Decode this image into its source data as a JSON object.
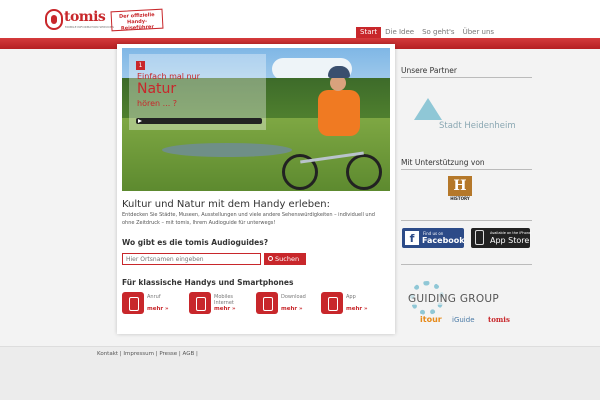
{
  "header": {
    "logo_text": "tomis",
    "logo_tagline": "MOBILE INFORMATION SERVICES",
    "stamp_text": "Der offizielle Handy-Reiseführer"
  },
  "nav": {
    "items": [
      {
        "label": "Start",
        "active": true
      },
      {
        "label": "Die Idee",
        "active": false
      },
      {
        "label": "So geht's",
        "active": false
      },
      {
        "label": "Über uns",
        "active": false
      }
    ]
  },
  "hero": {
    "badge_number": "1",
    "line1": "Einfach mal nur",
    "line2": "Natur",
    "line3": "hören ... ?"
  },
  "main": {
    "headline": "Kultur und Natur mit dem Handy erleben:",
    "intro": "Entdecken Sie Städte, Museen, Ausstellungen und viele andere Sehenswürdigkeiten – individuell und ohne Zeitdruck – mit tomis, Ihrem Audioguide für unterwegs!",
    "search_question": "Wo gibt es die tomis Audioguides?",
    "search_placeholder": "Hier Ortsnamen eingeben",
    "search_button": "Suchen",
    "subheading": "Für klassische Handys und Smartphones",
    "features": [
      {
        "title": "Anruf",
        "more": "mehr »"
      },
      {
        "title": "Mobiles Internet",
        "more": "mehr »"
      },
      {
        "title": "Download",
        "more": "mehr »"
      },
      {
        "title": "App",
        "more": "mehr »"
      }
    ]
  },
  "sidebar": {
    "partner_heading": "Unsere Partner",
    "partner_name": "Stadt Heidenheim",
    "support_heading": "Mit Unterstützung von",
    "history_logo": "H",
    "history_label": "HISTORY",
    "facebook_small": "Find us on",
    "facebook_big": "Facebook",
    "appstore_small": "Available on the iPhone",
    "appstore_big": "App Store",
    "guiding_group": "GUIDING GROUP",
    "guiding_brands": [
      "itour",
      "iGuide",
      "tomis"
    ]
  },
  "footer": {
    "links": "Kontakt | Impressum | Presse | AGB |"
  },
  "colors": {
    "brand_red": "#c8272b",
    "light_blue": "#8fc7d6"
  }
}
